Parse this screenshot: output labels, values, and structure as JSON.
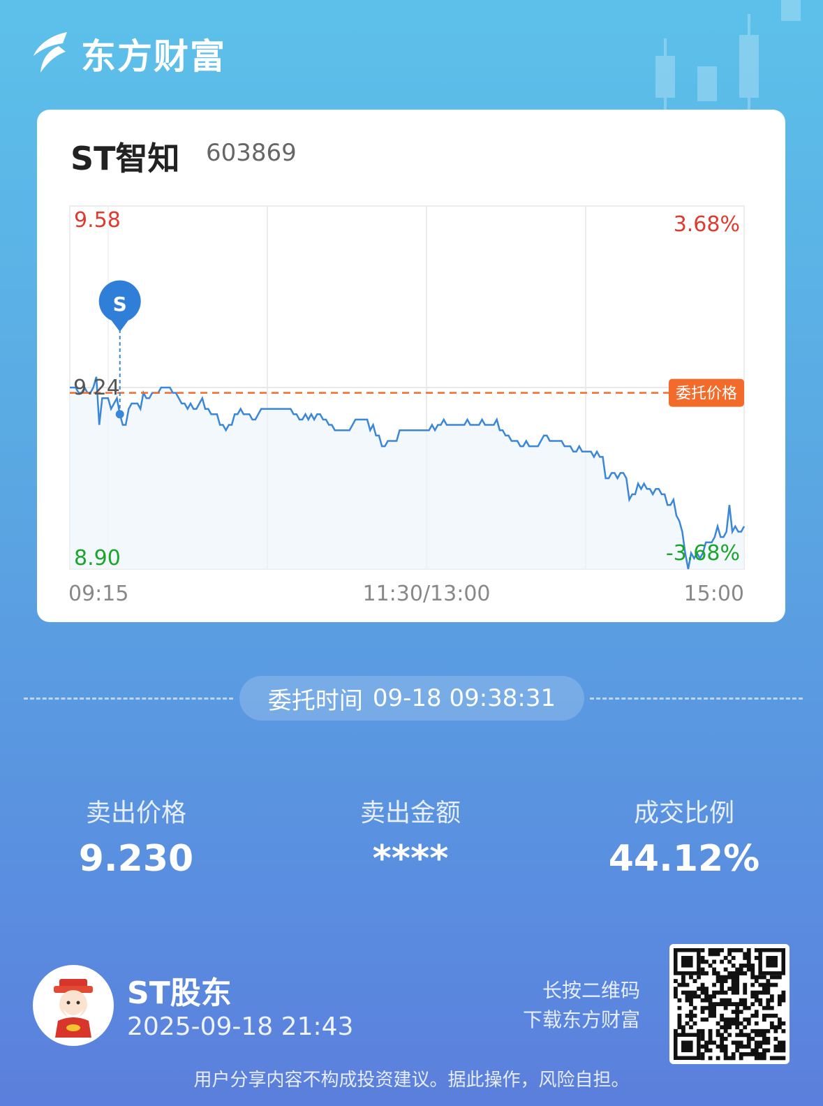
{
  "brand": {
    "name": "东方财富"
  },
  "stock": {
    "name": "ST智知",
    "code": "603869"
  },
  "chart_labels": {
    "high_price": "9.58",
    "mid_price": "9.24",
    "low_price": "8.90",
    "high_pct": "3.68%",
    "low_pct": "-3.68%",
    "order_tag": "委托价格",
    "time_start": "09:15",
    "time_mid": "11:30/13:00",
    "time_end": "15:00",
    "marker": "S"
  },
  "chart_data": {
    "type": "line",
    "y_range": [
      8.9,
      9.58
    ],
    "reference_price": 9.24,
    "order_price": 9.23,
    "x_ticks": [
      "09:15",
      "11:30/13:00",
      "15:00"
    ],
    "series": [
      {
        "values": [
          9.24,
          9.24,
          9.24,
          9.23,
          9.23,
          9.24,
          9.23,
          9.23,
          9.24,
          9.26,
          9.17,
          9.22,
          9.22,
          9.22,
          9.2,
          9.21,
          9.22,
          9.19,
          9.17,
          9.17,
          9.2,
          9.21,
          9.21,
          9.21,
          9.2,
          9.23,
          9.22,
          9.22,
          9.23,
          9.23,
          9.23,
          9.24,
          9.24,
          9.24,
          9.24,
          9.23,
          9.23,
          9.22,
          9.21,
          9.21,
          9.2,
          9.21,
          9.2,
          9.2,
          9.21,
          9.22,
          9.2,
          9.2,
          9.19,
          9.19,
          9.19,
          9.17,
          9.17,
          9.16,
          9.17,
          9.17,
          9.19,
          9.19,
          9.2,
          9.19,
          9.19,
          9.19,
          9.18,
          9.18,
          9.19,
          9.2,
          9.2,
          9.2,
          9.2,
          9.2,
          9.2,
          9.2,
          9.2,
          9.2,
          9.2,
          9.2,
          9.19,
          9.19,
          9.18,
          9.18,
          9.19,
          9.18,
          9.19,
          9.18,
          9.19,
          9.19,
          9.18,
          9.18,
          9.17,
          9.17,
          9.16,
          9.16,
          9.16,
          9.16,
          9.16,
          9.16,
          9.17,
          9.18,
          9.18,
          9.18,
          9.18,
          9.18,
          9.16,
          9.17,
          9.15,
          9.15,
          9.13,
          9.13,
          9.14,
          9.14,
          9.14,
          9.14,
          9.16,
          9.16,
          9.16,
          9.16,
          9.16,
          9.16,
          9.16,
          9.16,
          9.16,
          9.16,
          9.16,
          9.17,
          9.16,
          9.17,
          9.17,
          9.18,
          9.17,
          9.17,
          9.17,
          9.17,
          9.17,
          9.17,
          9.17,
          9.18,
          9.17,
          9.17,
          9.17,
          9.17,
          9.18,
          9.17,
          9.17,
          9.17,
          9.17,
          9.18,
          9.16,
          9.16,
          9.15,
          9.15,
          9.14,
          9.14,
          9.14,
          9.13,
          9.13,
          9.14,
          9.13,
          9.13,
          9.13,
          9.13,
          9.14,
          9.15,
          9.15,
          9.14,
          9.14,
          9.14,
          9.14,
          9.14,
          9.13,
          9.13,
          9.13,
          9.12,
          9.12,
          9.13,
          9.12,
          9.12,
          9.12,
          9.12,
          9.11,
          9.12,
          9.11,
          9.11,
          9.07,
          9.07,
          9.08,
          9.08,
          9.07,
          9.08,
          9.08,
          9.07,
          9.03,
          9.04,
          9.04,
          9.06,
          9.05,
          9.06,
          9.05,
          9.05,
          9.04,
          9.05,
          9.05,
          9.04,
          9.04,
          9.02,
          9.02,
          9.03,
          9.0,
          8.99,
          8.97,
          8.93,
          8.9,
          8.93,
          8.92,
          8.93,
          8.92,
          8.93,
          8.95,
          8.95,
          8.95,
          8.96,
          8.98,
          8.96,
          8.96,
          8.97,
          9.02,
          8.97,
          8.98,
          8.97,
          8.97,
          8.98
        ]
      }
    ],
    "sell_marker": {
      "index": 17,
      "label": "S"
    }
  },
  "order_time": {
    "label": "委托时间",
    "value": "09-18 09:38:31"
  },
  "stats": [
    {
      "label": "卖出价格",
      "value": "9.230"
    },
    {
      "label": "卖出金额",
      "value": "****"
    },
    {
      "label": "成交比例",
      "value": "44.12%"
    }
  ],
  "user": {
    "name": "ST股东",
    "datetime": "2025-09-18 21:43"
  },
  "qr": {
    "hint_line1": "长按二维码",
    "hint_line2": "下载东方财富"
  },
  "disclaimer": "用户分享内容不构成投资建议。据此操作，风险自担。",
  "colors": {
    "up": "#e03a2f",
    "down": "#1aa52d",
    "line": "#3a86d9",
    "order": "#f26b2b"
  }
}
